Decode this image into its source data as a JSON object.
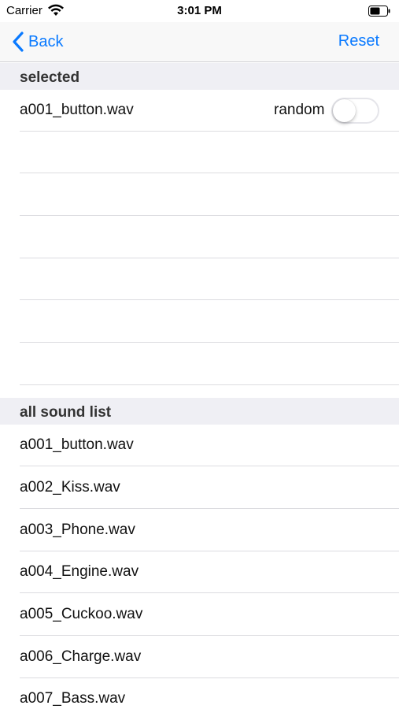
{
  "status_bar": {
    "carrier": "Carrier",
    "time": "3:01 PM",
    "icons": [
      "wifi-icon",
      "battery-icon"
    ]
  },
  "nav": {
    "back_label": "Back",
    "reset_label": "Reset",
    "accent_color": "#0a7aff"
  },
  "selected_section": {
    "title": "selected",
    "item": {
      "name": "a001_button.wav",
      "random_label": "random",
      "random_on": false
    },
    "empty_rows": 6
  },
  "all_section": {
    "title": "all sound list",
    "items": [
      "a001_button.wav",
      "a002_Kiss.wav",
      "a003_Phone.wav",
      "a004_Engine.wav",
      "a005_Cuckoo.wav",
      "a006_Charge.wav",
      "a007_Bass.wav"
    ]
  }
}
